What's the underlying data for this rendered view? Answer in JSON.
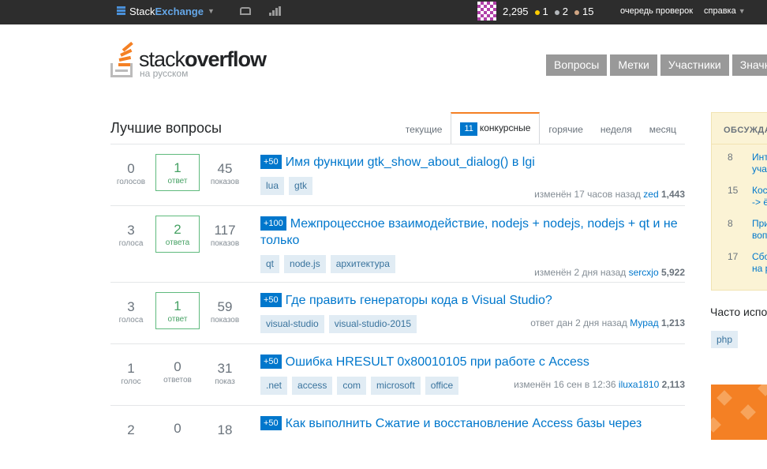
{
  "topbar": {
    "brand_part1": "Stack",
    "brand_part2": "Exchange",
    "reputation": "2,295",
    "gold_badges": "1",
    "silver_badges": "2",
    "bronze_badges": "15",
    "review_link": "очередь проверок",
    "help_link": "справка",
    "icons": [
      "stackexchange-icon",
      "inbox-icon",
      "achievements-icon",
      "avatar"
    ],
    "colors": {
      "gold": "#ffcc01",
      "silver": "#b4b8bc",
      "bronze": "#d1a684"
    }
  },
  "header": {
    "logo_word1": "stack",
    "logo_word2": "overflow",
    "logo_sub": "на русском",
    "nav": [
      "Вопросы",
      "Метки",
      "Участники",
      "Значки"
    ]
  },
  "main": {
    "title": "Лучшие вопросы",
    "tabs": [
      {
        "label": "текущие"
      },
      {
        "label": "конкурсные",
        "count": "11",
        "active": true
      },
      {
        "label": "горячие"
      },
      {
        "label": "неделя"
      },
      {
        "label": "месяц"
      }
    ],
    "questions": [
      {
        "votes": "0",
        "votes_label": "голосов",
        "answers": "1",
        "answers_label": "ответ",
        "views": "45",
        "views_label": "показов",
        "bounty": "+50",
        "title": "Имя функции gtk_show_about_dialog() в lgi",
        "tags": [
          "lua",
          "gtk"
        ],
        "meta_action": "изменён 17 часов назад",
        "meta_user": "zed",
        "meta_rep": "1,443"
      },
      {
        "votes": "3",
        "votes_label": "голоса",
        "answers": "2",
        "answers_label": "ответа",
        "views": "117",
        "views_label": "показов",
        "bounty": "+100",
        "title": "Межпроцессное взаимодействие, nodejs + nodejs, nodejs + qt и не только",
        "tags": [
          "qt",
          "node.js",
          "архитектура"
        ],
        "meta_action": "изменён 2 дня назад",
        "meta_user": "sercxjo",
        "meta_rep": "5,922"
      },
      {
        "votes": "3",
        "votes_label": "голоса",
        "answers": "1",
        "answers_label": "ответ",
        "views": "59",
        "views_label": "показов",
        "bounty": "+50",
        "title": "Где править генераторы кода в Visual Studio?",
        "tags": [
          "visual-studio",
          "visual-studio-2015"
        ],
        "meta_action": "ответ дан 2 дня назад",
        "meta_user": "Мурад",
        "meta_rep": "1,213"
      },
      {
        "votes": "1",
        "votes_label": "голос",
        "answers": "0",
        "answers_label": "ответов",
        "views": "31",
        "views_label": "показ",
        "bounty": "+50",
        "title": "Ошибка HRESULT 0x80010105 при работе с Access",
        "tags": [
          ".net",
          "access",
          "com",
          "microsoft",
          "office"
        ],
        "meta_action": "изменён 16 сен в 12:36",
        "meta_user": "iluxa1810",
        "meta_rep": "2,113"
      },
      {
        "votes": "2",
        "votes_label": "",
        "answers": "0",
        "answers_label": "",
        "views": "18",
        "views_label": "",
        "bounty": "+50",
        "title": "Как выполнить Сжатие и восстановление Access базы через",
        "tags": [],
        "meta_action": "",
        "meta_user": "",
        "meta_rep": ""
      }
    ]
  },
  "sidebar": {
    "header": "ОБСУЖДАЕМ",
    "items": [
      {
        "num": "8",
        "line1": "Инт",
        "line2": "уча"
      },
      {
        "num": "15",
        "line1": "Кос",
        "line2": "-> ё"
      },
      {
        "num": "8",
        "line1": "При",
        "line2": "воп"
      },
      {
        "num": "17",
        "line1": "Сбо",
        "line2": "на р"
      }
    ],
    "often_title": "Часто испо",
    "often_tag": "php"
  }
}
